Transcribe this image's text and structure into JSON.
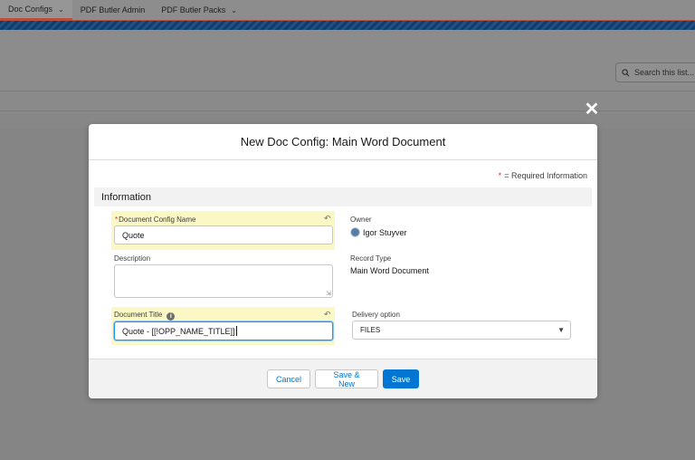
{
  "topnav": {
    "tabs": [
      {
        "label": "Doc Configs",
        "has_dropdown": true,
        "active": true
      },
      {
        "label": "PDF Butler Admin",
        "has_dropdown": false,
        "active": false
      },
      {
        "label": "PDF Butler Packs",
        "has_dropdown": true,
        "active": false
      }
    ]
  },
  "background": {
    "search_placeholder": "Search this list..."
  },
  "modal": {
    "title": "New Doc Config: Main Word Document",
    "required_star": "*",
    "required_info": "= Required Information",
    "section_title": "Information",
    "fields": {
      "doc_config_name": {
        "label": "Document Config Name",
        "required": "*",
        "value": "Quote"
      },
      "description": {
        "label": "Description",
        "value": ""
      },
      "document_title": {
        "label": "Document Title",
        "value": "Quote - [[!OPP_NAME_TITLE]]"
      },
      "owner": {
        "label": "Owner",
        "value": "Igor Stuyver"
      },
      "record_type": {
        "label": "Record Type",
        "value": "Main Word Document"
      },
      "delivery_option": {
        "label": "Delivery option",
        "value": "FILES"
      }
    },
    "buttons": {
      "cancel": "Cancel",
      "save_new": "Save & New",
      "save": "Save"
    }
  },
  "colors": {
    "brand": "#0176d3",
    "highlight": "#fbf8c5",
    "required": "#c23934"
  },
  "icons": {
    "close": "close-icon",
    "undo": "undo-icon",
    "info": "info-icon",
    "search": "search-icon",
    "chevron": "chevron-down-icon"
  }
}
